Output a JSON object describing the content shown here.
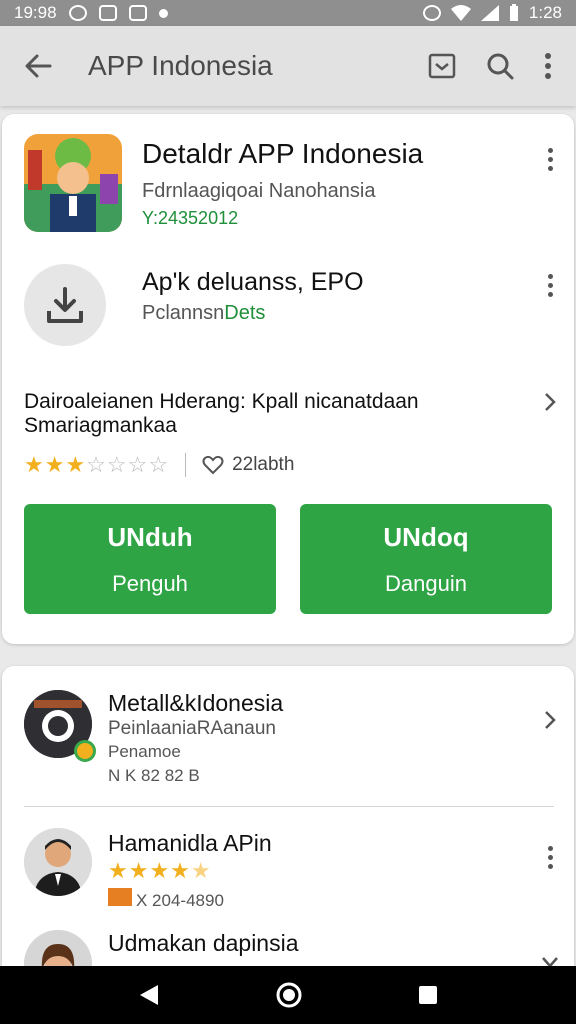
{
  "status_bar": {
    "time": "19:98",
    "right_time": "1:28"
  },
  "app_bar": {
    "title": "APP Indonesia"
  },
  "main_app": {
    "title": "Detaldr APP Indonesia",
    "developer": "Fdrnlaagiqoai Nanohansia",
    "meta": "Y:24352012"
  },
  "second_app": {
    "title": "Ap'k deluanss, EPO",
    "subtitle_prefix": "Pclannsn",
    "subtitle_highlight": "Dets"
  },
  "description": {
    "line1": "Dairoaleianen Hderang: Kpall nicanatdaan",
    "line2": "Smariagmankaa"
  },
  "rating": {
    "stars": 3,
    "max": 7,
    "likes": "22labth"
  },
  "buttons": [
    {
      "label": "UNduh",
      "sublabel": "Penguh"
    },
    {
      "label": "UNdoq",
      "sublabel": "Danguin"
    }
  ],
  "list": [
    {
      "title": "Metall&kIdonesia",
      "sub1": "PeinlaaniaRAanaun",
      "sub2": "Penamoe",
      "meta": "N K 82 82 B"
    },
    {
      "title": "Hamanidla APin",
      "stars": 4.5,
      "meta": "X 204-4890"
    },
    {
      "title": "Udmakan dapinsia"
    }
  ],
  "colors": {
    "accent": "#2ea445",
    "star": "#f2b01e",
    "status_bar": "#8f8f8f"
  }
}
